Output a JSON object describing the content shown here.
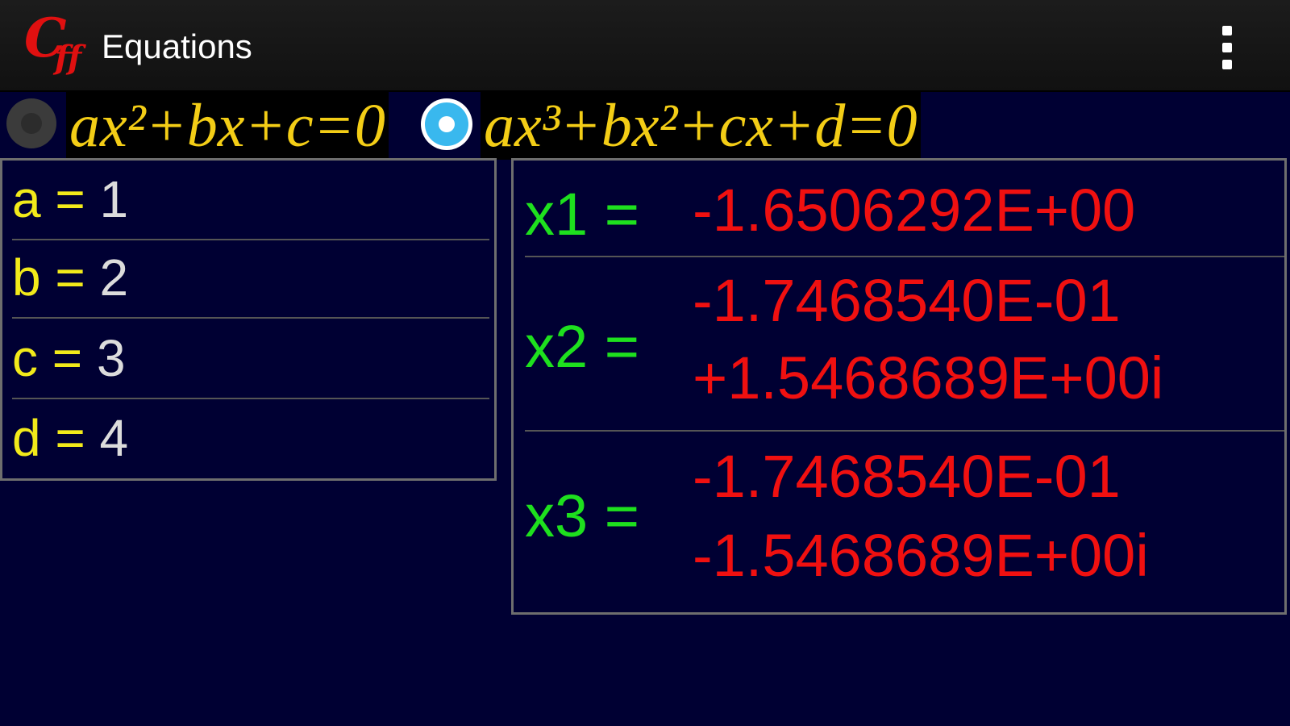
{
  "app": {
    "logo_text_big": "C",
    "logo_text_small": "ff",
    "title": "Equations"
  },
  "icons": {
    "overflow": "overflow-menu-icon"
  },
  "equations": {
    "quadratic_label": "ax²+bx+c=0",
    "cubic_label": "ax³+bx²+cx+d=0",
    "selected": "cubic"
  },
  "coefficients": [
    {
      "name": "a",
      "eq": "=",
      "value": "1"
    },
    {
      "name": "b",
      "eq": "=",
      "value": "2"
    },
    {
      "name": "c",
      "eq": "=",
      "value": "3"
    },
    {
      "name": "d",
      "eq": "=",
      "value": "4"
    }
  ],
  "results": [
    {
      "label": "x1 =",
      "line1": "-1.6506292E+00",
      "line2": ""
    },
    {
      "label": "x2 =",
      "line1": "-1.7468540E-01",
      "line2": "+1.5468689E+00i"
    },
    {
      "label": "x3 =",
      "line1": "-1.7468540E-01",
      "line2": "-1.5468689E+00i"
    }
  ],
  "colors": {
    "background": "#000033",
    "equation": "#f3cd16",
    "coef_name": "#f2ea1a",
    "result_label": "#1ee01e",
    "result_value": "#f01010",
    "radio_selected": "#39b8ee"
  }
}
